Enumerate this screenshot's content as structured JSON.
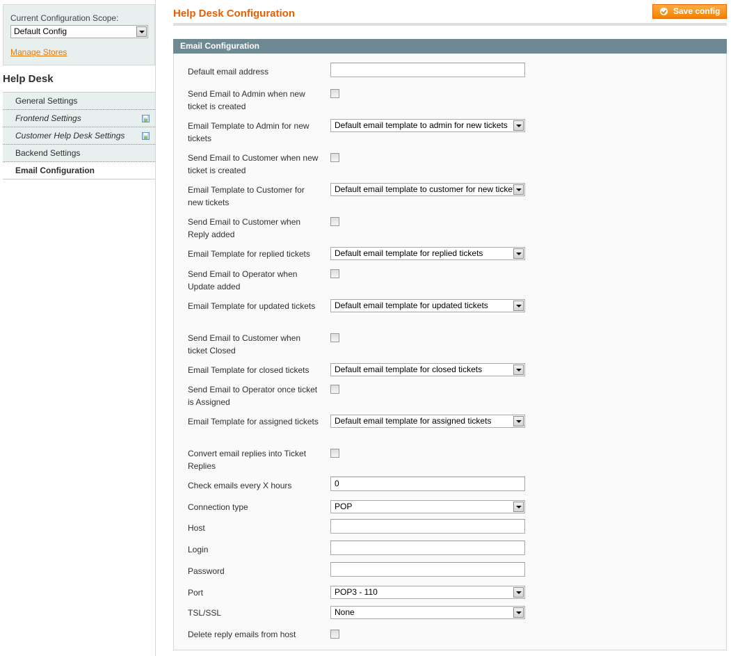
{
  "scope": {
    "label": "Current Configuration Scope:",
    "selected": "Default Config",
    "manage_stores": "Manage Stores"
  },
  "sidebar": {
    "title": "Help Desk",
    "items": [
      {
        "label": "General Settings",
        "italic": false,
        "icon": null,
        "active": false
      },
      {
        "label": "Frontend Settings",
        "italic": true,
        "icon": "save-icon",
        "active": false
      },
      {
        "label": "Customer Help Desk Settings",
        "italic": true,
        "icon": "save-icon",
        "active": false
      },
      {
        "label": "Backend Settings",
        "italic": false,
        "icon": null,
        "active": false
      },
      {
        "label": "Email Configuration",
        "italic": false,
        "icon": null,
        "active": true
      }
    ]
  },
  "header": {
    "title": "Help Desk Configuration",
    "save_label": "Save config"
  },
  "section": {
    "title": "Email Configuration",
    "fields": [
      {
        "label": "Default email address",
        "type": "text",
        "value": ""
      },
      {
        "label": "Send Email to Admin when new ticket is created",
        "type": "checkbox",
        "checked": false
      },
      {
        "label": "Email Template to Admin for new tickets",
        "type": "select",
        "value": "Default email template to admin for new tickets"
      },
      {
        "label": "Send Email to Customer when new ticket is created",
        "type": "checkbox",
        "checked": false
      },
      {
        "label": "Email Template to Customer for new tickets",
        "type": "select",
        "value": "Default email template to customer for new tickets"
      },
      {
        "label": "Send Email to Customer when Reply added",
        "type": "checkbox",
        "checked": false
      },
      {
        "label": "Email Template for replied tickets",
        "type": "select",
        "value": "Default email template for replied tickets"
      },
      {
        "label": "Send Email to Operator when Update added",
        "type": "checkbox",
        "checked": false
      },
      {
        "label": "Email Template for updated tickets",
        "type": "select",
        "value": "Default email template for updated tickets"
      },
      {
        "label": "Send Email to Customer when ticket Closed",
        "type": "checkbox",
        "checked": false
      },
      {
        "label": "Email Template for closed tickets",
        "type": "select",
        "value": "Default email template for closed tickets"
      },
      {
        "label": "Send Email to Operator once ticket is Assigned",
        "type": "checkbox",
        "checked": false
      },
      {
        "label": "Email Template for assigned tickets",
        "type": "select",
        "value": "Default email template for assigned tickets"
      },
      {
        "label": "Convert email replies into Ticket Replies",
        "type": "checkbox",
        "checked": false
      },
      {
        "label": "Check emails every X hours",
        "type": "text",
        "value": "0"
      },
      {
        "label": "Connection type",
        "type": "select",
        "value": "POP"
      },
      {
        "label": "Host",
        "type": "text",
        "value": ""
      },
      {
        "label": "Login",
        "type": "text",
        "value": ""
      },
      {
        "label": "Password",
        "type": "text",
        "value": ""
      },
      {
        "label": "Port",
        "type": "select",
        "value": "POP3 - 110"
      },
      {
        "label": "TSL/SSL",
        "type": "select",
        "value": "None"
      },
      {
        "label": "Delete reply emails from host",
        "type": "checkbox",
        "checked": false
      }
    ]
  }
}
